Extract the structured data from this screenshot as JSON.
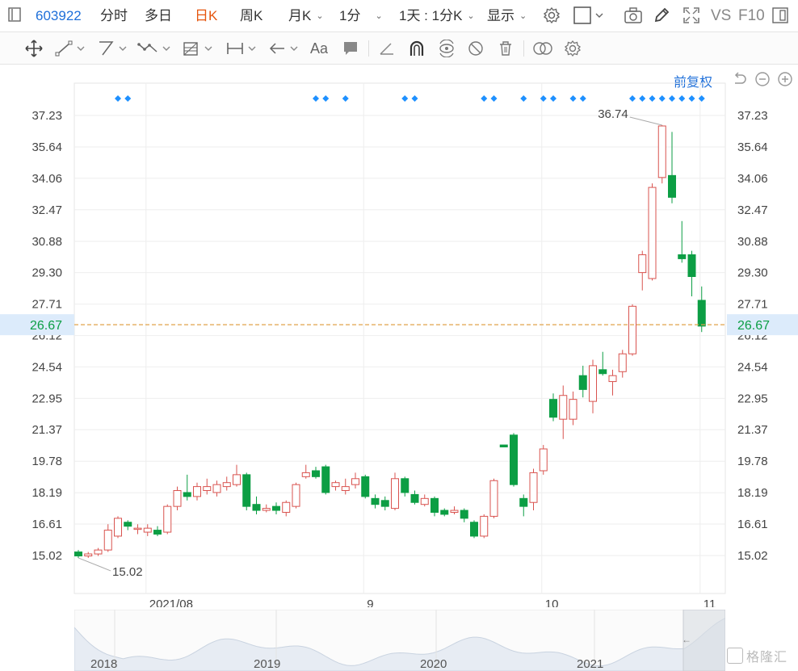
{
  "topbar": {
    "stock_code": "603922",
    "items": [
      "分时",
      "多日",
      "日K",
      "周K",
      "月K",
      "1分",
      "1天 : 1分K",
      "显示"
    ],
    "active": "日K",
    "vs": "VS",
    "f10": "F10"
  },
  "adjust_label": "前复权",
  "colors": {
    "up": "#d9534f",
    "down": "#0c9e44",
    "marker": "#1e90ff",
    "dashed": "#e0a34a",
    "current_bg": "#dcebfb",
    "current_text": "#0c9e44"
  },
  "chart_data": {
    "type": "candlestick",
    "y_ticks": [
      "15.02",
      "16.61",
      "18.19",
      "19.78",
      "21.37",
      "22.95",
      "24.54",
      "26.12",
      "27.71",
      "29.30",
      "30.88",
      "32.47",
      "34.06",
      "35.64",
      "37.23"
    ],
    "ylim": [
      15.02,
      37.23
    ],
    "x_labels": [
      {
        "label": "2021/08",
        "index": 7
      },
      {
        "label": "9",
        "index": 29
      },
      {
        "label": "10",
        "index": 47
      },
      {
        "label": "11",
        "index": 63
      }
    ],
    "current_price": "26.67",
    "high_label": "36.74",
    "low_label": "15.02",
    "marker_indices": [
      4,
      5,
      24,
      25,
      27,
      33,
      34,
      41,
      42,
      45,
      47,
      48,
      50,
      51,
      56,
      57,
      58,
      59,
      60,
      61,
      62,
      63
    ],
    "candles": [
      [
        15.2,
        15.0,
        15.3,
        14.9
      ],
      [
        15.0,
        15.1,
        15.2,
        14.9
      ],
      [
        15.1,
        15.3,
        15.4,
        15.0
      ],
      [
        15.3,
        16.3,
        16.6,
        15.2
      ],
      [
        16.0,
        16.9,
        17.0,
        15.9
      ],
      [
        16.7,
        16.5,
        16.8,
        16.3
      ],
      [
        16.4,
        16.4,
        16.6,
        16.1
      ],
      [
        16.2,
        16.4,
        16.6,
        16.0
      ],
      [
        16.3,
        16.1,
        16.5,
        16.0
      ],
      [
        16.2,
        17.5,
        17.6,
        16.1
      ],
      [
        17.5,
        18.3,
        18.5,
        17.3
      ],
      [
        18.2,
        18.0,
        19.1,
        17.8
      ],
      [
        18.0,
        18.5,
        18.7,
        17.8
      ],
      [
        18.3,
        18.5,
        18.9,
        18.1
      ],
      [
        18.2,
        18.6,
        18.8,
        18.0
      ],
      [
        18.5,
        18.7,
        19.0,
        18.3
      ],
      [
        18.6,
        19.1,
        19.6,
        18.5
      ],
      [
        19.1,
        17.5,
        19.2,
        17.3
      ],
      [
        17.6,
        17.3,
        18.0,
        17.1
      ],
      [
        17.3,
        17.4,
        17.6,
        17.2
      ],
      [
        17.5,
        17.3,
        17.7,
        17.1
      ],
      [
        17.2,
        17.7,
        17.8,
        17.0
      ],
      [
        17.5,
        18.6,
        18.7,
        17.4
      ],
      [
        19.0,
        19.2,
        19.6,
        18.9
      ],
      [
        19.3,
        19.0,
        19.5,
        18.9
      ],
      [
        19.5,
        18.2,
        19.6,
        18.1
      ],
      [
        18.5,
        18.7,
        18.8,
        18.3
      ],
      [
        18.3,
        18.5,
        18.9,
        18.1
      ],
      [
        18.6,
        18.9,
        19.2,
        18.4
      ],
      [
        19.0,
        18.0,
        19.1,
        17.9
      ],
      [
        17.9,
        17.6,
        18.1,
        17.4
      ],
      [
        17.8,
        17.5,
        18.0,
        17.3
      ],
      [
        17.4,
        18.9,
        19.2,
        17.3
      ],
      [
        18.9,
        18.2,
        19.0,
        18.0
      ],
      [
        18.1,
        17.7,
        18.3,
        17.6
      ],
      [
        17.6,
        17.9,
        18.1,
        17.5
      ],
      [
        17.9,
        17.2,
        18.0,
        17.0
      ],
      [
        17.3,
        17.1,
        17.4,
        17.0
      ],
      [
        17.2,
        17.3,
        17.5,
        17.1
      ],
      [
        17.3,
        16.9,
        17.4,
        16.7
      ],
      [
        16.7,
        16.0,
        16.8,
        15.9
      ],
      [
        16.0,
        17.0,
        17.1,
        15.9
      ],
      [
        17.0,
        18.8,
        18.9,
        16.9
      ],
      [
        20.6,
        20.5,
        20.6,
        20.5
      ],
      [
        21.1,
        18.6,
        21.2,
        18.5
      ],
      [
        17.9,
        17.5,
        18.1,
        17.0
      ],
      [
        17.7,
        19.2,
        19.4,
        17.3
      ],
      [
        19.3,
        20.4,
        20.6,
        19.1
      ],
      [
        22.9,
        22.0,
        23.2,
        21.8
      ],
      [
        21.9,
        23.1,
        23.6,
        20.9
      ],
      [
        21.9,
        22.9,
        23.3,
        21.6
      ],
      [
        24.1,
        23.4,
        24.6,
        23.0
      ],
      [
        22.8,
        24.6,
        24.9,
        22.2
      ],
      [
        24.4,
        24.2,
        25.3,
        24.1
      ],
      [
        23.8,
        24.1,
        24.4,
        23.1
      ],
      [
        24.3,
        25.2,
        25.4,
        24.0
      ],
      [
        25.2,
        27.6,
        27.7,
        25.1
      ],
      [
        29.3,
        30.2,
        30.4,
        28.4
      ],
      [
        29.0,
        33.6,
        33.8,
        28.9
      ],
      [
        34.1,
        36.7,
        36.74,
        33.8
      ],
      [
        34.2,
        33.1,
        36.4,
        32.8
      ],
      [
        30.2,
        30.0,
        31.9,
        29.8
      ],
      [
        30.2,
        29.1,
        30.4,
        28.1
      ],
      [
        27.9,
        26.6,
        28.6,
        26.3
      ]
    ]
  },
  "navigator": {
    "labels": [
      "2018",
      "2019",
      "2020",
      "2021"
    ]
  },
  "watermark": "格隆汇"
}
